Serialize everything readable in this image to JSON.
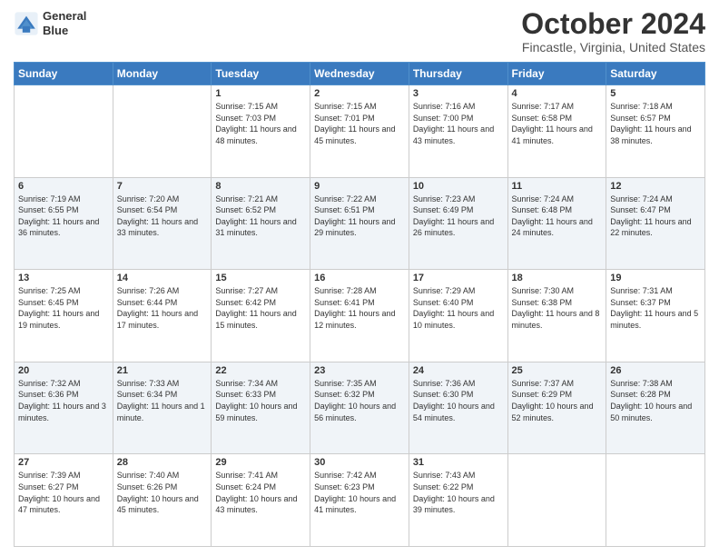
{
  "header": {
    "logo": {
      "line1": "General",
      "line2": "Blue"
    },
    "title": "October 2024",
    "location": "Fincastle, Virginia, United States"
  },
  "days_of_week": [
    "Sunday",
    "Monday",
    "Tuesday",
    "Wednesday",
    "Thursday",
    "Friday",
    "Saturday"
  ],
  "weeks": [
    [
      {
        "num": "",
        "sunrise": "",
        "sunset": "",
        "daylight": ""
      },
      {
        "num": "",
        "sunrise": "",
        "sunset": "",
        "daylight": ""
      },
      {
        "num": "1",
        "sunrise": "Sunrise: 7:15 AM",
        "sunset": "Sunset: 7:03 PM",
        "daylight": "Daylight: 11 hours and 48 minutes."
      },
      {
        "num": "2",
        "sunrise": "Sunrise: 7:15 AM",
        "sunset": "Sunset: 7:01 PM",
        "daylight": "Daylight: 11 hours and 45 minutes."
      },
      {
        "num": "3",
        "sunrise": "Sunrise: 7:16 AM",
        "sunset": "Sunset: 7:00 PM",
        "daylight": "Daylight: 11 hours and 43 minutes."
      },
      {
        "num": "4",
        "sunrise": "Sunrise: 7:17 AM",
        "sunset": "Sunset: 6:58 PM",
        "daylight": "Daylight: 11 hours and 41 minutes."
      },
      {
        "num": "5",
        "sunrise": "Sunrise: 7:18 AM",
        "sunset": "Sunset: 6:57 PM",
        "daylight": "Daylight: 11 hours and 38 minutes."
      }
    ],
    [
      {
        "num": "6",
        "sunrise": "Sunrise: 7:19 AM",
        "sunset": "Sunset: 6:55 PM",
        "daylight": "Daylight: 11 hours and 36 minutes."
      },
      {
        "num": "7",
        "sunrise": "Sunrise: 7:20 AM",
        "sunset": "Sunset: 6:54 PM",
        "daylight": "Daylight: 11 hours and 33 minutes."
      },
      {
        "num": "8",
        "sunrise": "Sunrise: 7:21 AM",
        "sunset": "Sunset: 6:52 PM",
        "daylight": "Daylight: 11 hours and 31 minutes."
      },
      {
        "num": "9",
        "sunrise": "Sunrise: 7:22 AM",
        "sunset": "Sunset: 6:51 PM",
        "daylight": "Daylight: 11 hours and 29 minutes."
      },
      {
        "num": "10",
        "sunrise": "Sunrise: 7:23 AM",
        "sunset": "Sunset: 6:49 PM",
        "daylight": "Daylight: 11 hours and 26 minutes."
      },
      {
        "num": "11",
        "sunrise": "Sunrise: 7:24 AM",
        "sunset": "Sunset: 6:48 PM",
        "daylight": "Daylight: 11 hours and 24 minutes."
      },
      {
        "num": "12",
        "sunrise": "Sunrise: 7:24 AM",
        "sunset": "Sunset: 6:47 PM",
        "daylight": "Daylight: 11 hours and 22 minutes."
      }
    ],
    [
      {
        "num": "13",
        "sunrise": "Sunrise: 7:25 AM",
        "sunset": "Sunset: 6:45 PM",
        "daylight": "Daylight: 11 hours and 19 minutes."
      },
      {
        "num": "14",
        "sunrise": "Sunrise: 7:26 AM",
        "sunset": "Sunset: 6:44 PM",
        "daylight": "Daylight: 11 hours and 17 minutes."
      },
      {
        "num": "15",
        "sunrise": "Sunrise: 7:27 AM",
        "sunset": "Sunset: 6:42 PM",
        "daylight": "Daylight: 11 hours and 15 minutes."
      },
      {
        "num": "16",
        "sunrise": "Sunrise: 7:28 AM",
        "sunset": "Sunset: 6:41 PM",
        "daylight": "Daylight: 11 hours and 12 minutes."
      },
      {
        "num": "17",
        "sunrise": "Sunrise: 7:29 AM",
        "sunset": "Sunset: 6:40 PM",
        "daylight": "Daylight: 11 hours and 10 minutes."
      },
      {
        "num": "18",
        "sunrise": "Sunrise: 7:30 AM",
        "sunset": "Sunset: 6:38 PM",
        "daylight": "Daylight: 11 hours and 8 minutes."
      },
      {
        "num": "19",
        "sunrise": "Sunrise: 7:31 AM",
        "sunset": "Sunset: 6:37 PM",
        "daylight": "Daylight: 11 hours and 5 minutes."
      }
    ],
    [
      {
        "num": "20",
        "sunrise": "Sunrise: 7:32 AM",
        "sunset": "Sunset: 6:36 PM",
        "daylight": "Daylight: 11 hours and 3 minutes."
      },
      {
        "num": "21",
        "sunrise": "Sunrise: 7:33 AM",
        "sunset": "Sunset: 6:34 PM",
        "daylight": "Daylight: 11 hours and 1 minute."
      },
      {
        "num": "22",
        "sunrise": "Sunrise: 7:34 AM",
        "sunset": "Sunset: 6:33 PM",
        "daylight": "Daylight: 10 hours and 59 minutes."
      },
      {
        "num": "23",
        "sunrise": "Sunrise: 7:35 AM",
        "sunset": "Sunset: 6:32 PM",
        "daylight": "Daylight: 10 hours and 56 minutes."
      },
      {
        "num": "24",
        "sunrise": "Sunrise: 7:36 AM",
        "sunset": "Sunset: 6:30 PM",
        "daylight": "Daylight: 10 hours and 54 minutes."
      },
      {
        "num": "25",
        "sunrise": "Sunrise: 7:37 AM",
        "sunset": "Sunset: 6:29 PM",
        "daylight": "Daylight: 10 hours and 52 minutes."
      },
      {
        "num": "26",
        "sunrise": "Sunrise: 7:38 AM",
        "sunset": "Sunset: 6:28 PM",
        "daylight": "Daylight: 10 hours and 50 minutes."
      }
    ],
    [
      {
        "num": "27",
        "sunrise": "Sunrise: 7:39 AM",
        "sunset": "Sunset: 6:27 PM",
        "daylight": "Daylight: 10 hours and 47 minutes."
      },
      {
        "num": "28",
        "sunrise": "Sunrise: 7:40 AM",
        "sunset": "Sunset: 6:26 PM",
        "daylight": "Daylight: 10 hours and 45 minutes."
      },
      {
        "num": "29",
        "sunrise": "Sunrise: 7:41 AM",
        "sunset": "Sunset: 6:24 PM",
        "daylight": "Daylight: 10 hours and 43 minutes."
      },
      {
        "num": "30",
        "sunrise": "Sunrise: 7:42 AM",
        "sunset": "Sunset: 6:23 PM",
        "daylight": "Daylight: 10 hours and 41 minutes."
      },
      {
        "num": "31",
        "sunrise": "Sunrise: 7:43 AM",
        "sunset": "Sunset: 6:22 PM",
        "daylight": "Daylight: 10 hours and 39 minutes."
      },
      {
        "num": "",
        "sunrise": "",
        "sunset": "",
        "daylight": ""
      },
      {
        "num": "",
        "sunrise": "",
        "sunset": "",
        "daylight": ""
      }
    ]
  ]
}
